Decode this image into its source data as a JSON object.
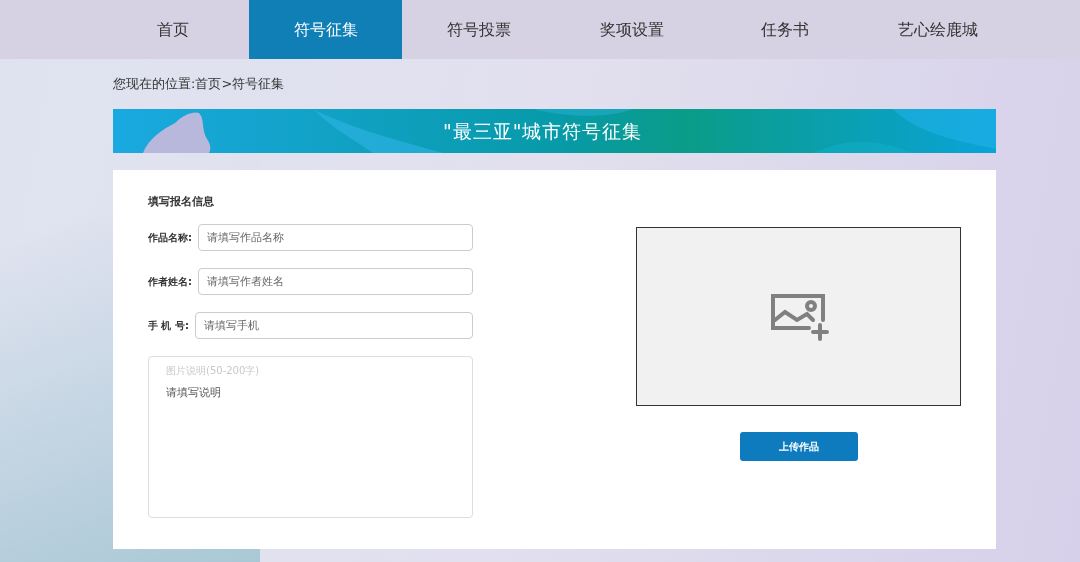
{
  "nav": {
    "items": [
      {
        "label": "首页",
        "selected": false
      },
      {
        "label": "符号征集",
        "selected": true
      },
      {
        "label": "符号投票",
        "selected": false
      },
      {
        "label": "奖项设置",
        "selected": false
      },
      {
        "label": "任务书",
        "selected": false
      },
      {
        "label": "艺心绘鹿城",
        "selected": false
      }
    ]
  },
  "breadcrumb": "您现在的位置:首页>符号征集",
  "banner": {
    "title": "\"最三亚\"城市符号征集"
  },
  "form": {
    "heading": "填写报名信息",
    "fields": [
      {
        "label": "作品名称:",
        "placeholder": "请填写作品名称"
      },
      {
        "label": "作者姓名:",
        "placeholder": "请填写作者姓名"
      },
      {
        "label": "手 机 号:",
        "placeholder": "请填写手机"
      }
    ],
    "description": {
      "caption": "图片说明(50-200字)",
      "placeholder": "请填写说明"
    }
  },
  "upload": {
    "button": "上传作品"
  }
}
